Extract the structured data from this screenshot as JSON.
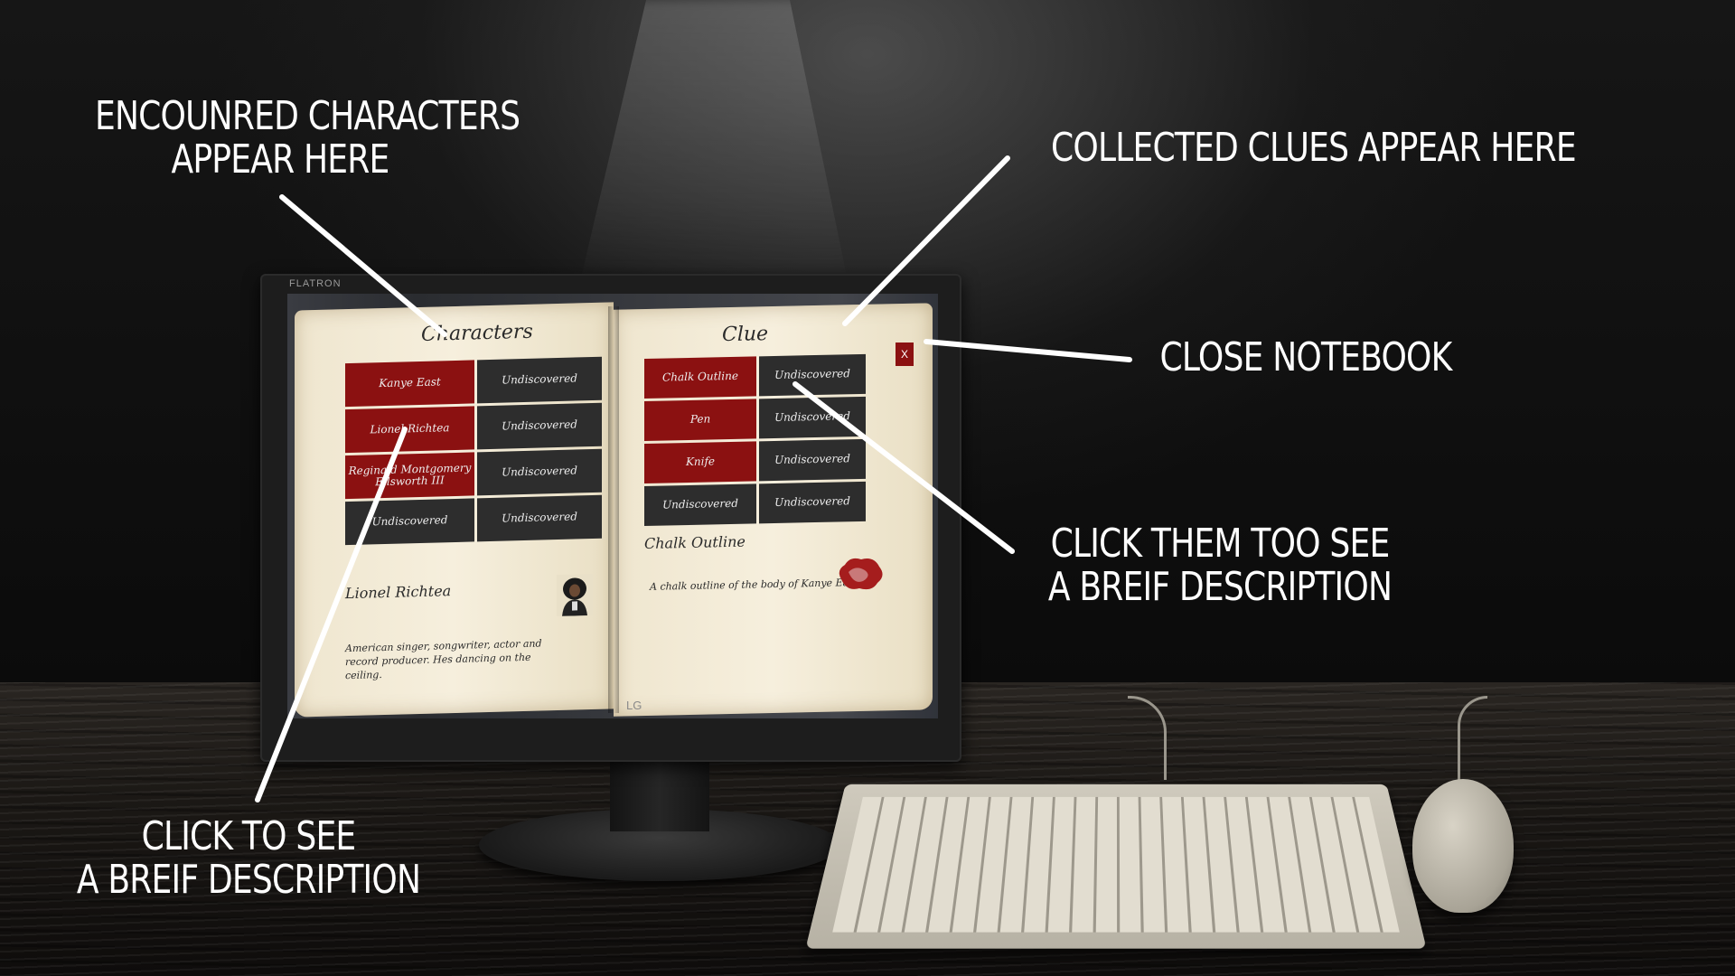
{
  "callouts": {
    "characters": "ENCOUNRED CHARACTERS\nAPPEAR HERE",
    "characters_line1": "ENCOUNRED CHARACTERS",
    "characters_line2": "APPEAR HERE",
    "clues": "COLLECTED CLUES APPEAR HERE",
    "close": "CLOSE NOTEBOOK",
    "clue_click_line1": "CLICK THEM TOO SEE",
    "clue_click_line2": "A BREIF DESCRIPTION",
    "char_click_line1": "CLICK TO SEE",
    "char_click_line2": "A BREIF DESCRIPTION"
  },
  "monitor": {
    "brand_top": "FLATRON",
    "brand_bottom": "LG"
  },
  "notebook": {
    "characters_title": "Characters",
    "clue_title": "Clue",
    "close_label": "X",
    "characters": [
      {
        "label": "Kanye East",
        "state": "found"
      },
      {
        "label": "Undiscovered",
        "state": "undiscovered"
      },
      {
        "label": "Lionel Richtea",
        "state": "found"
      },
      {
        "label": "Undiscovered",
        "state": "undiscovered"
      },
      {
        "label": "Reginald Montgomery Ellsworth III",
        "state": "found"
      },
      {
        "label": "Undiscovered",
        "state": "undiscovered"
      },
      {
        "label": "Undiscovered",
        "state": "undiscovered"
      },
      {
        "label": "Undiscovered",
        "state": "undiscovered"
      }
    ],
    "clues": [
      {
        "label": "Chalk Outline",
        "state": "found"
      },
      {
        "label": "Undiscovered",
        "state": "undiscovered"
      },
      {
        "label": "Pen",
        "state": "found"
      },
      {
        "label": "Undiscovered",
        "state": "undiscovered"
      },
      {
        "label": "Knife",
        "state": "found"
      },
      {
        "label": "Undiscovered",
        "state": "undiscovered"
      },
      {
        "label": "Undiscovered",
        "state": "undiscovered"
      },
      {
        "label": "Undiscovered",
        "state": "undiscovered"
      }
    ],
    "selected_character": {
      "name": "Lionel Richtea",
      "description": "American singer, songwriter, actor and record producer. Hes dancing on the ceiling."
    },
    "selected_clue": {
      "name": "Chalk Outline",
      "description": "A chalk outline of the body of Kanye East!"
    }
  },
  "colors": {
    "found_cell": "#8b1111",
    "undiscovered_cell": "#2d2d2d",
    "callout_text": "#ffffff"
  }
}
